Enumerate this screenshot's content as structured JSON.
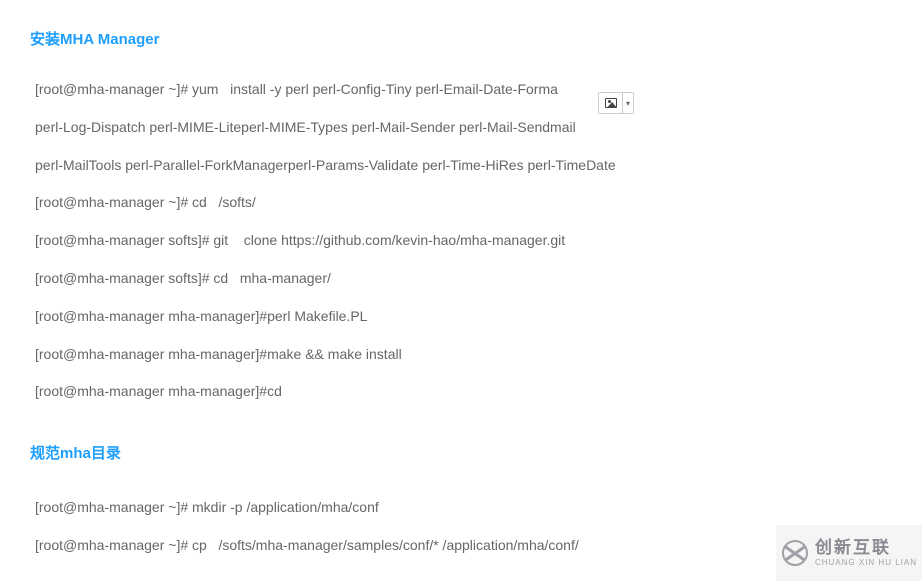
{
  "sections": [
    {
      "title": "安装MHA Manager",
      "lines": [
        "[root@mha-manager ~]# yum   install -y perl perl-Config-Tiny perl-Email-Date-Forma",
        "perl-Log-Dispatch perl-MIME-Liteperl-MIME-Types perl-Mail-Sender perl-Mail-Sendmail",
        "perl-MailTools perl-Parallel-ForkManagerperl-Params-Validate perl-Time-HiRes perl-TimeDate",
        "[root@mha-manager ~]# cd   /softs/",
        "[root@mha-manager softs]# git    clone https://github.com/kevin-hao/mha-manager.git",
        "[root@mha-manager softs]# cd   mha-manager/",
        "[root@mha-manager mha-manager]#perl Makefile.PL",
        "[root@mha-manager mha-manager]#make && make install",
        "[root@mha-manager mha-manager]#cd"
      ]
    },
    {
      "title": "规范mha目录",
      "lines": [
        "[root@mha-manager ~]# mkdir -p /application/mha/conf",
        "[root@mha-manager ~]# cp   /softs/mha-manager/samples/conf/* /application/mha/conf/"
      ]
    }
  ],
  "brand": {
    "cn": "创新互联",
    "en": "CHUANG XIN HU LIAN"
  }
}
